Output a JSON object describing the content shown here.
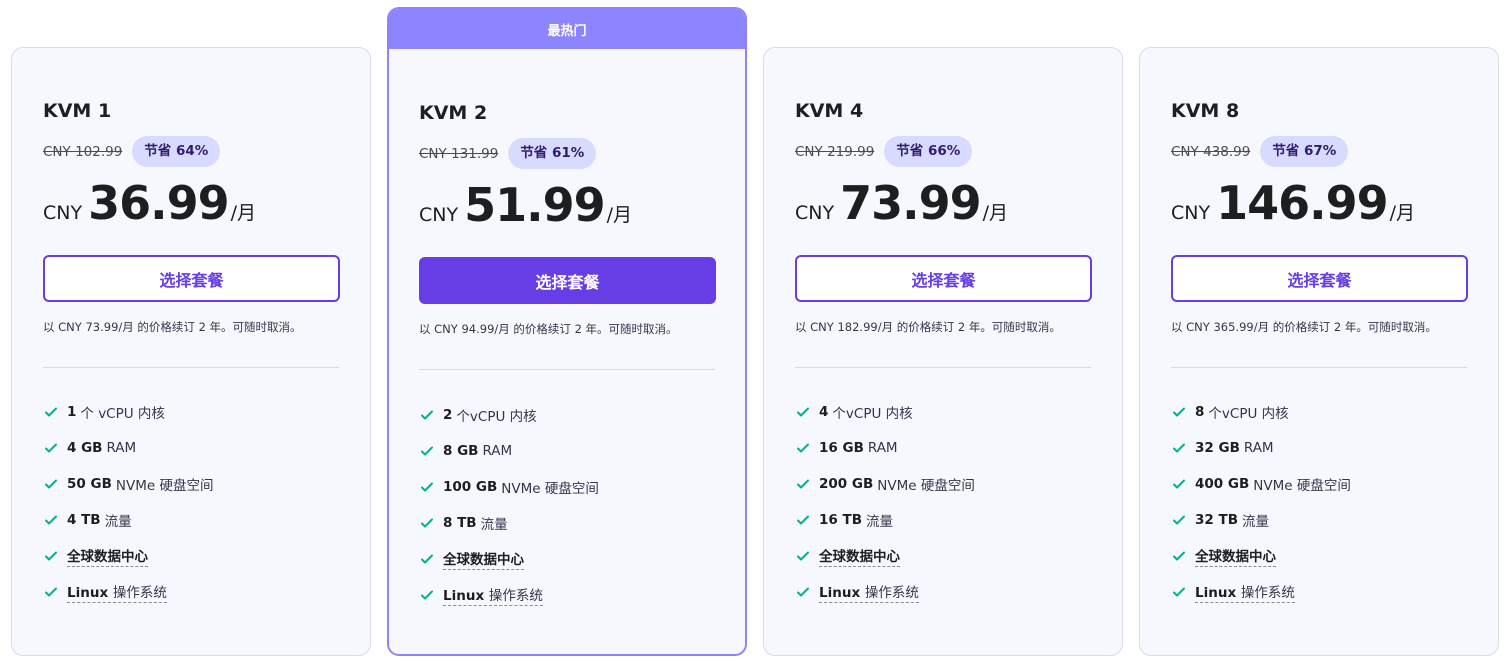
{
  "colors": {
    "accent": "#673de6",
    "featured_border": "#8c85ff",
    "badge_bg": "#d8daff",
    "check": "#00b090",
    "card_bg": "#f7f8fe"
  },
  "cards": [
    {
      "name": "KVM 1",
      "old_price": "CNY 102.99",
      "save": "节省 64%",
      "currency": "CNY",
      "amount": "36.99",
      "per": "/月",
      "cta": "选择套餐",
      "renew": "以 CNY 73.99/月 的价格续订 2 年。可随时取消。",
      "features": [
        {
          "bold": "1",
          "text": "个 vCPU 内核"
        },
        {
          "bold": "4 GB",
          "text": "RAM"
        },
        {
          "bold": "50 GB",
          "text": "NVMe 硬盘空间"
        },
        {
          "bold": "4 TB",
          "text": "流量"
        },
        {
          "bold": "全球数据中心",
          "text": ""
        },
        {
          "bold": "Linux",
          "text": "操作系统"
        }
      ]
    },
    {
      "ribbon": "最热门",
      "name": "KVM 2",
      "old_price": "CNY 131.99",
      "save": "节省 61%",
      "currency": "CNY",
      "amount": "51.99",
      "per": "/月",
      "cta": "选择套餐",
      "renew": "以 CNY 94.99/月 的价格续订 2 年。可随时取消。",
      "features": [
        {
          "bold": "2",
          "text": "个vCPU 内核"
        },
        {
          "bold": "8 GB",
          "text": "RAM"
        },
        {
          "bold": "100 GB",
          "text": "NVMe 硬盘空间"
        },
        {
          "bold": "8 TB",
          "text": "流量"
        },
        {
          "bold": "全球数据中心",
          "text": ""
        },
        {
          "bold": "Linux",
          "text": "操作系统"
        }
      ]
    },
    {
      "name": "KVM 4",
      "old_price": "CNY 219.99",
      "save": "节省 66%",
      "currency": "CNY",
      "amount": "73.99",
      "per": "/月",
      "cta": "选择套餐",
      "renew": "以 CNY 182.99/月 的价格续订 2 年。可随时取消。",
      "features": [
        {
          "bold": "4",
          "text": "个vCPU 内核"
        },
        {
          "bold": "16 GB",
          "text": "RAM"
        },
        {
          "bold": "200 GB",
          "text": "NVMe 硬盘空间"
        },
        {
          "bold": "16 TB",
          "text": "流量"
        },
        {
          "bold": "全球数据中心",
          "text": ""
        },
        {
          "bold": "Linux",
          "text": "操作系统"
        }
      ]
    },
    {
      "name": "KVM 8",
      "old_price": "CNY 438.99",
      "save": "节省 67%",
      "currency": "CNY",
      "amount": "146.99",
      "per": "/月",
      "cta": "选择套餐",
      "renew": "以 CNY 365.99/月 的价格续订 2 年。可随时取消。",
      "features": [
        {
          "bold": "8",
          "text": "个vCPU 内核"
        },
        {
          "bold": "32 GB",
          "text": "RAM"
        },
        {
          "bold": "400 GB",
          "text": "NVMe 硬盘空间"
        },
        {
          "bold": "32 TB",
          "text": "流量"
        },
        {
          "bold": "全球数据中心",
          "text": ""
        },
        {
          "bold": "Linux",
          "text": "操作系统"
        }
      ]
    }
  ]
}
